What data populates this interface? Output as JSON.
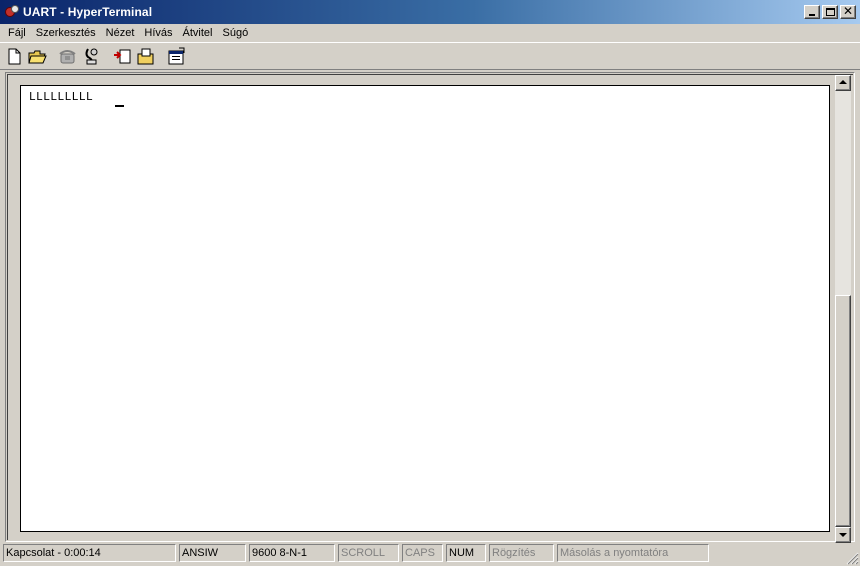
{
  "window": {
    "title": "UART - HyperTerminal",
    "icon": "hyperterminal-app-icon"
  },
  "menu": [
    "Fájl",
    "Szerkesztés",
    "Nézet",
    "Hívás",
    "Átvitel",
    "Súgó"
  ],
  "toolbar": {
    "icons": [
      "new-file-icon",
      "open-folder-icon",
      "connect-phone-icon",
      "disconnect-phone-icon",
      "send-file-icon",
      "receive-file-icon",
      "properties-icon"
    ]
  },
  "terminal": {
    "text": "LLLLLLLLL"
  },
  "status": {
    "connection": "Kapcsolat - 0:00:14",
    "emulation": "ANSIW",
    "settings": "9600 8-N-1",
    "scroll": "SCROLL",
    "caps": "CAPS",
    "num": "NUM",
    "capture": "Rögzítés",
    "print_echo": "Másolás a nyomtatóra"
  },
  "colors": {
    "titlebar_start": "#0a246a",
    "titlebar_end": "#a6caf0",
    "chrome": "#d4d0c8",
    "terminal_bg": "#ffffff"
  }
}
